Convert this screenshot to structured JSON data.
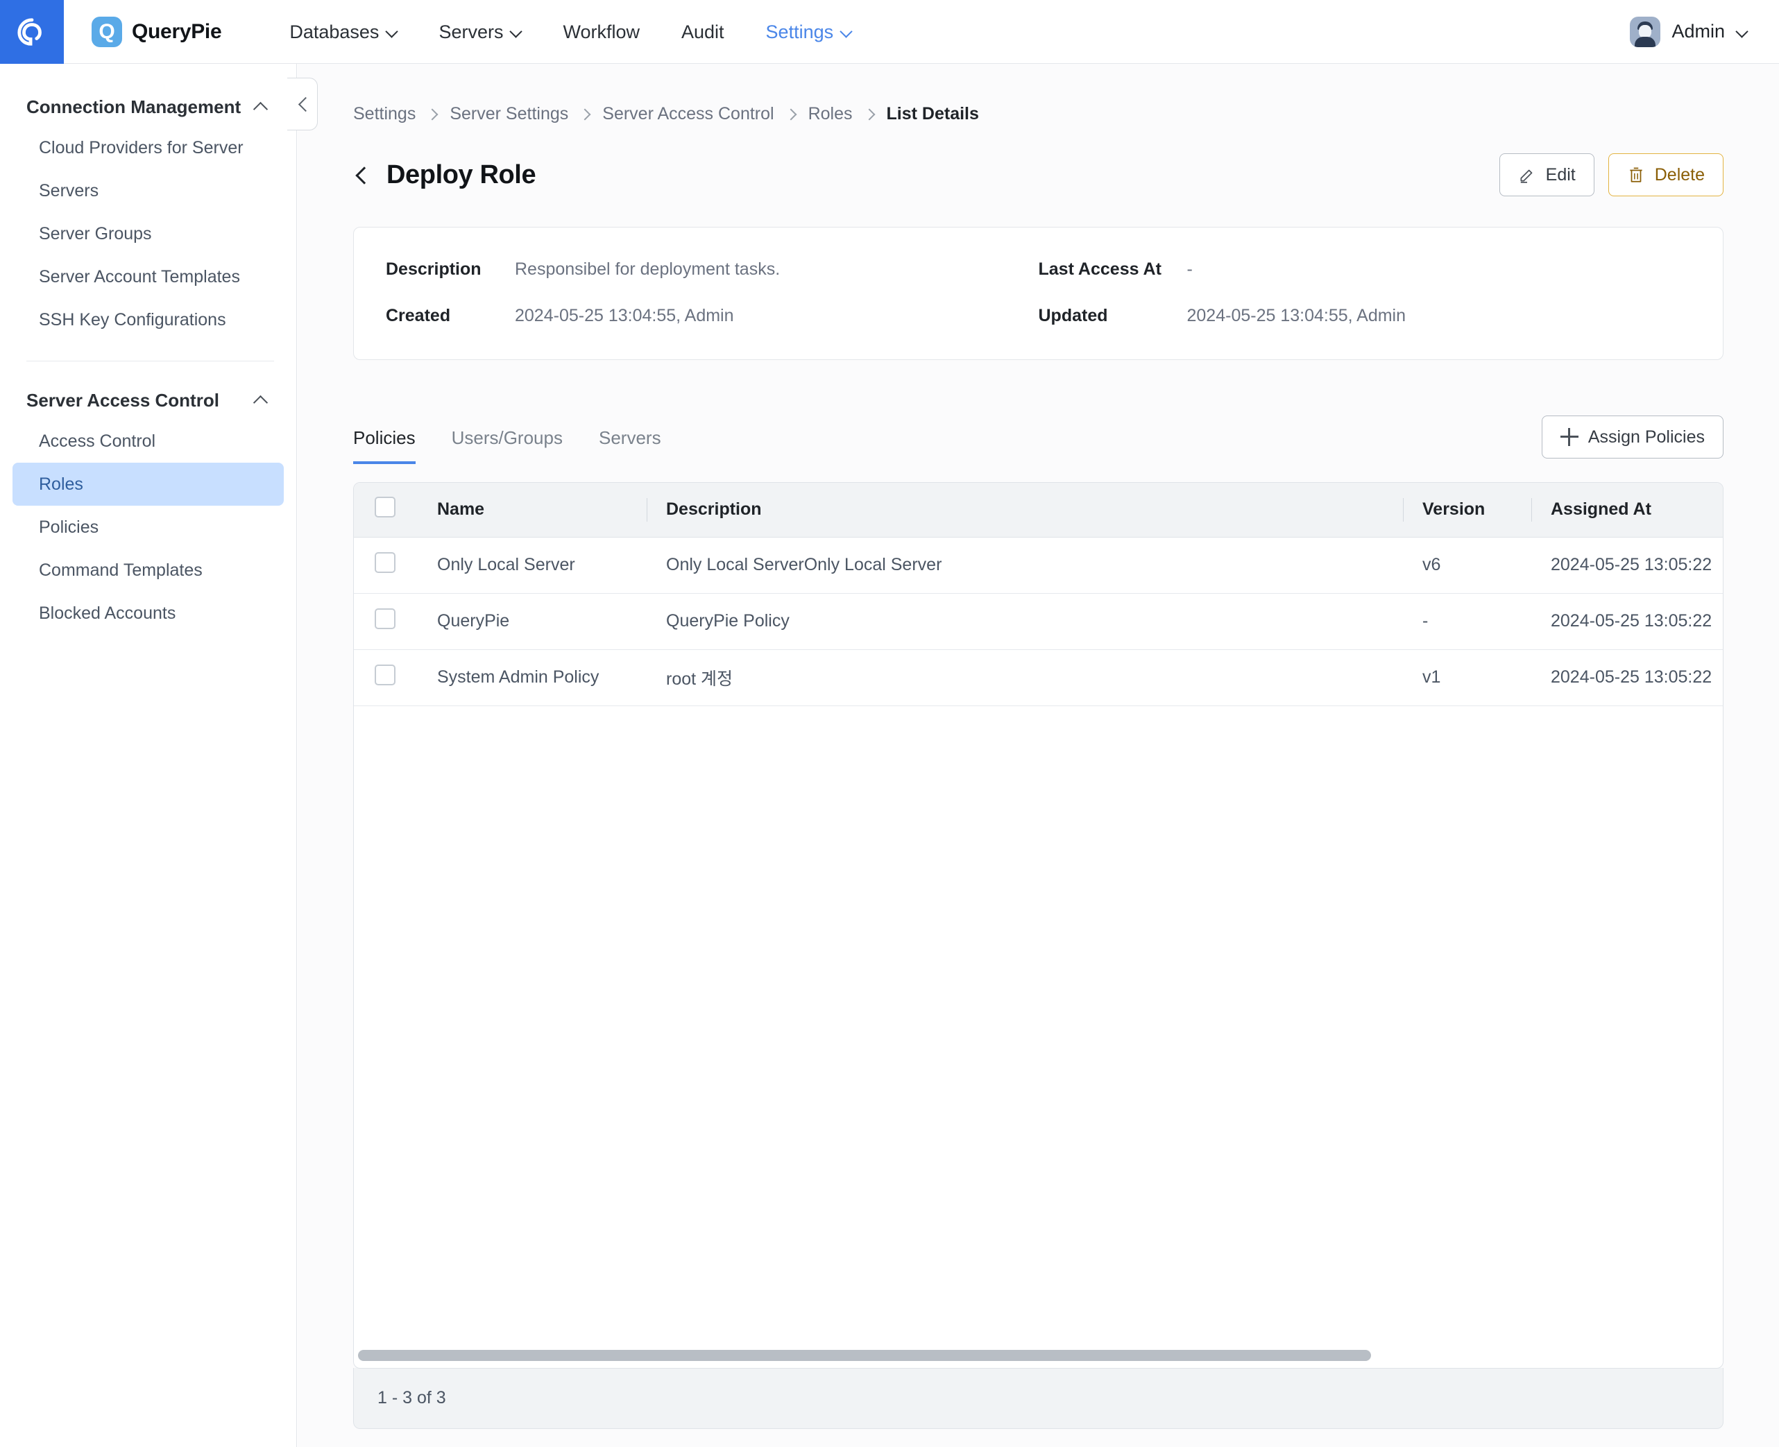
{
  "topbar": {
    "app_icon": "querypie-app-icon",
    "brand_mark": "Q",
    "brand_name": "QueryPie",
    "nav": [
      {
        "label": "Databases",
        "has_caret": true,
        "active": false
      },
      {
        "label": "Servers",
        "has_caret": true,
        "active": false
      },
      {
        "label": "Workflow",
        "has_caret": false,
        "active": false
      },
      {
        "label": "Audit",
        "has_caret": false,
        "active": false
      },
      {
        "label": "Settings",
        "has_caret": true,
        "active": true
      }
    ],
    "user": {
      "name": "Admin",
      "avatar": "user-avatar",
      "caret": true
    }
  },
  "sidebar": {
    "groups": [
      {
        "title": "Connection Management",
        "collapse_icon": "chevron-up-icon",
        "items": [
          {
            "label": "Cloud Providers for Server",
            "selected": false
          },
          {
            "label": "Servers",
            "selected": false
          },
          {
            "label": "Server Groups",
            "selected": false
          },
          {
            "label": "Server Account Templates",
            "selected": false
          },
          {
            "label": "SSH Key Configurations",
            "selected": false
          }
        ]
      },
      {
        "title": "Server Access Control",
        "collapse_icon": "chevron-up-icon",
        "items": [
          {
            "label": "Access Control",
            "selected": false
          },
          {
            "label": "Roles",
            "selected": true
          },
          {
            "label": "Policies",
            "selected": false
          },
          {
            "label": "Command Templates",
            "selected": false
          },
          {
            "label": "Blocked Accounts",
            "selected": false
          }
        ]
      }
    ],
    "collapse_button": "collapse-sidebar-icon"
  },
  "breadcrumb": [
    {
      "label": "Settings",
      "current": false
    },
    {
      "label": "Server Settings",
      "current": false
    },
    {
      "label": "Server Access Control",
      "current": false
    },
    {
      "label": "Roles",
      "current": false
    },
    {
      "label": "List Details",
      "current": true
    }
  ],
  "page": {
    "title": "Deploy Role",
    "back_icon": "chevron-left-icon",
    "actions": [
      {
        "label": "Edit",
        "icon": "pencil-icon",
        "style": "default"
      },
      {
        "label": "Delete",
        "icon": "trash-icon",
        "style": "danger"
      }
    ]
  },
  "info": {
    "description_label": "Description",
    "description_value": "Responsibel for deployment tasks.",
    "last_access_label": "Last Access At",
    "last_access_value": "-",
    "created_label": "Created",
    "created_value": "2024-05-25 13:04:55, Admin",
    "updated_label": "Updated",
    "updated_value": "2024-05-25 13:04:55, Admin"
  },
  "tabs": [
    {
      "label": "Policies",
      "active": true
    },
    {
      "label": "Users/Groups",
      "active": false
    },
    {
      "label": "Servers",
      "active": false
    }
  ],
  "assign_button": {
    "label": "Assign Policies",
    "icon": "plus-icon"
  },
  "table": {
    "columns": [
      "Name",
      "Description",
      "Version",
      "Assigned At"
    ],
    "select_all_checkbox": "select-all-checkbox",
    "rows": [
      {
        "name": "Only Local Server",
        "description": "Only Local ServerOnly Local Server",
        "version": "v6",
        "assigned_at": "2024-05-25 13:05:22"
      },
      {
        "name": "QueryPie",
        "description": "QueryPie Policy",
        "version": "-",
        "assigned_at": "2024-05-25 13:05:22"
      },
      {
        "name": "System Admin Policy",
        "description": "root 계정",
        "version": "v1",
        "assigned_at": "2024-05-25 13:05:22"
      }
    ]
  },
  "pagination": {
    "summary": "1 - 3 of 3"
  },
  "colors": {
    "accent": "#4a86e8",
    "app_square": "#2f6fe4",
    "brand_mark": "#5aaae8",
    "selected_nav": "#c8dfff",
    "danger_border": "#e3b341",
    "danger_text": "#8a5e06"
  }
}
